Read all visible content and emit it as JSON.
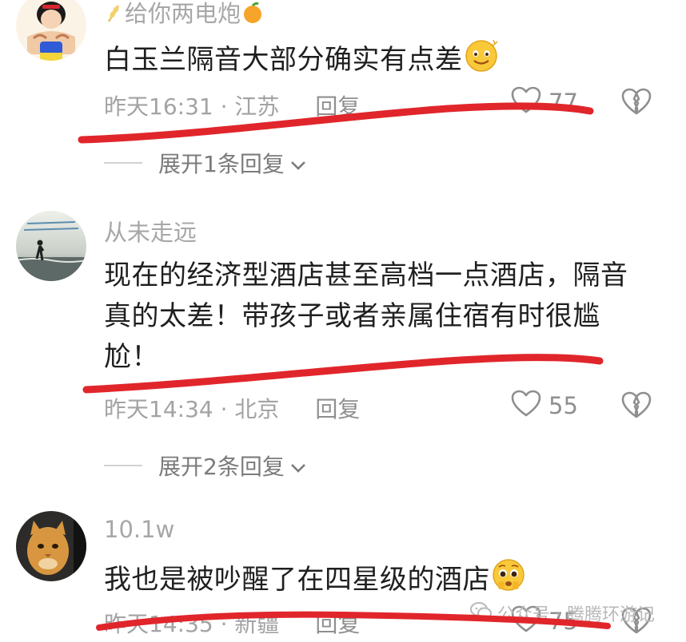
{
  "comments": [
    {
      "username": "给你两电炮",
      "text": "白玉兰隔音大部分确实有点差",
      "time": "昨天16:31",
      "location": "江苏",
      "reply_label": "回复",
      "likes": "77",
      "expand_label": "展开1条回复"
    },
    {
      "username": "从未走远",
      "text": "现在的经济型酒店甚至高档一点酒店，隔音真的太差！带孩子或者亲属住宿有时很尴尬！",
      "time": "昨天14:34",
      "location": "北京",
      "reply_label": "回复",
      "likes": "55",
      "expand_label": "展开2条回复"
    },
    {
      "username": "10.1w",
      "text": "我也是被吵醒了在四星级的酒店",
      "time": "昨天14:35",
      "location": "新疆",
      "reply_label": "回复",
      "likes": "75"
    }
  ],
  "meta_separator": "·",
  "watermark": {
    "text": "公众号 · 腾腾环游记",
    "icon": "wechat-icon"
  },
  "colors": {
    "annotation_red": "#e0262b",
    "text": "#1f1f1f",
    "muted": "#a3a3a3"
  },
  "icons": {
    "like": "heart-outline-icon",
    "dislike": "broken-heart-icon",
    "expand": "chevron-down-icon",
    "emoji_1": "smiling-emoji-icon",
    "emoji_3": "pleading-emoji-icon"
  }
}
